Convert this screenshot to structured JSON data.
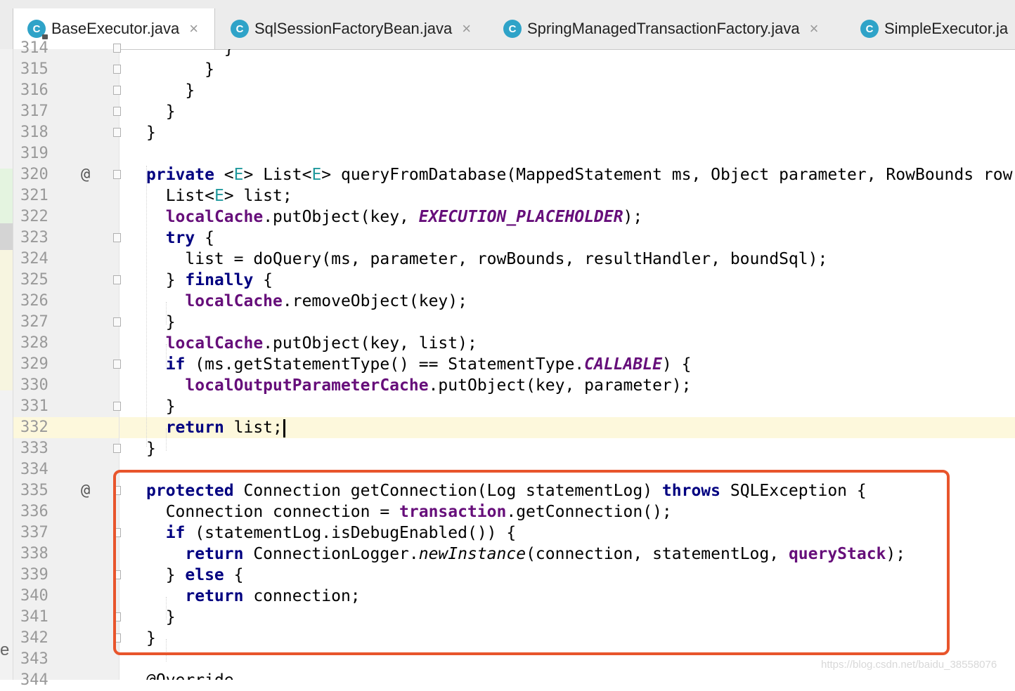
{
  "tabs": [
    {
      "label": "BaseExecutor.java",
      "icon": "class-icon",
      "closable": true,
      "active": true
    },
    {
      "label": "SqlSessionFactoryBean.java",
      "icon": "class-icon",
      "closable": true,
      "active": false
    },
    {
      "label": "SpringManagedTransactionFactory.java",
      "icon": "class-icon",
      "closable": true,
      "active": false
    },
    {
      "label": "SimpleExecutor.ja",
      "icon": "class-icon",
      "closable": false,
      "active": false
    }
  ],
  "editor": {
    "current_line": "332",
    "lines": [
      {
        "n": "314",
        "text": "        }"
      },
      {
        "n": "315",
        "text": "      }"
      },
      {
        "n": "316",
        "text": "    }"
      },
      {
        "n": "317",
        "text": "  }"
      },
      {
        "n": "318",
        "text": "}"
      },
      {
        "n": "319",
        "text": ""
      },
      {
        "n": "320",
        "text": "private <E> List<E> queryFromDatabase(MappedStatement ms, Object parameter, RowBounds row",
        "marker": "@"
      },
      {
        "n": "321",
        "text": "  List<E> list;"
      },
      {
        "n": "322",
        "text": "  localCache.putObject(key, EXECUTION_PLACEHOLDER);"
      },
      {
        "n": "323",
        "text": "  try {"
      },
      {
        "n": "324",
        "text": "    list = doQuery(ms, parameter, rowBounds, resultHandler, boundSql);"
      },
      {
        "n": "325",
        "text": "  } finally {"
      },
      {
        "n": "326",
        "text": "    localCache.removeObject(key);"
      },
      {
        "n": "327",
        "text": "  }"
      },
      {
        "n": "328",
        "text": "  localCache.putObject(key, list);"
      },
      {
        "n": "329",
        "text": "  if (ms.getStatementType() == StatementType.CALLABLE) {"
      },
      {
        "n": "330",
        "text": "    localOutputParameterCache.putObject(key, parameter);"
      },
      {
        "n": "331",
        "text": "  }"
      },
      {
        "n": "332",
        "text": "  return list;"
      },
      {
        "n": "333",
        "text": "}"
      },
      {
        "n": "334",
        "text": ""
      },
      {
        "n": "335",
        "text": "protected Connection getConnection(Log statementLog) throws SQLException {",
        "marker": "@"
      },
      {
        "n": "336",
        "text": "  Connection connection = transaction.getConnection();"
      },
      {
        "n": "337",
        "text": "  if (statementLog.isDebugEnabled()) {"
      },
      {
        "n": "338",
        "text": "    return ConnectionLogger.newInstance(connection, statementLog, queryStack);"
      },
      {
        "n": "339",
        "text": "  } else {"
      },
      {
        "n": "340",
        "text": "    return connection;"
      },
      {
        "n": "341",
        "text": "  }"
      },
      {
        "n": "342",
        "text": "}"
      },
      {
        "n": "343",
        "text": ""
      },
      {
        "n": "344",
        "text": "@Override"
      }
    ]
  },
  "left_edge_text": "e",
  "watermark": "https://blog.csdn.net/baidu_38558076",
  "colors": {
    "keyword": "#000080",
    "field": "#660e7a",
    "type_param": "#20999d",
    "highlight_box": "#e8552c",
    "current_line": "#fdf8dc"
  }
}
